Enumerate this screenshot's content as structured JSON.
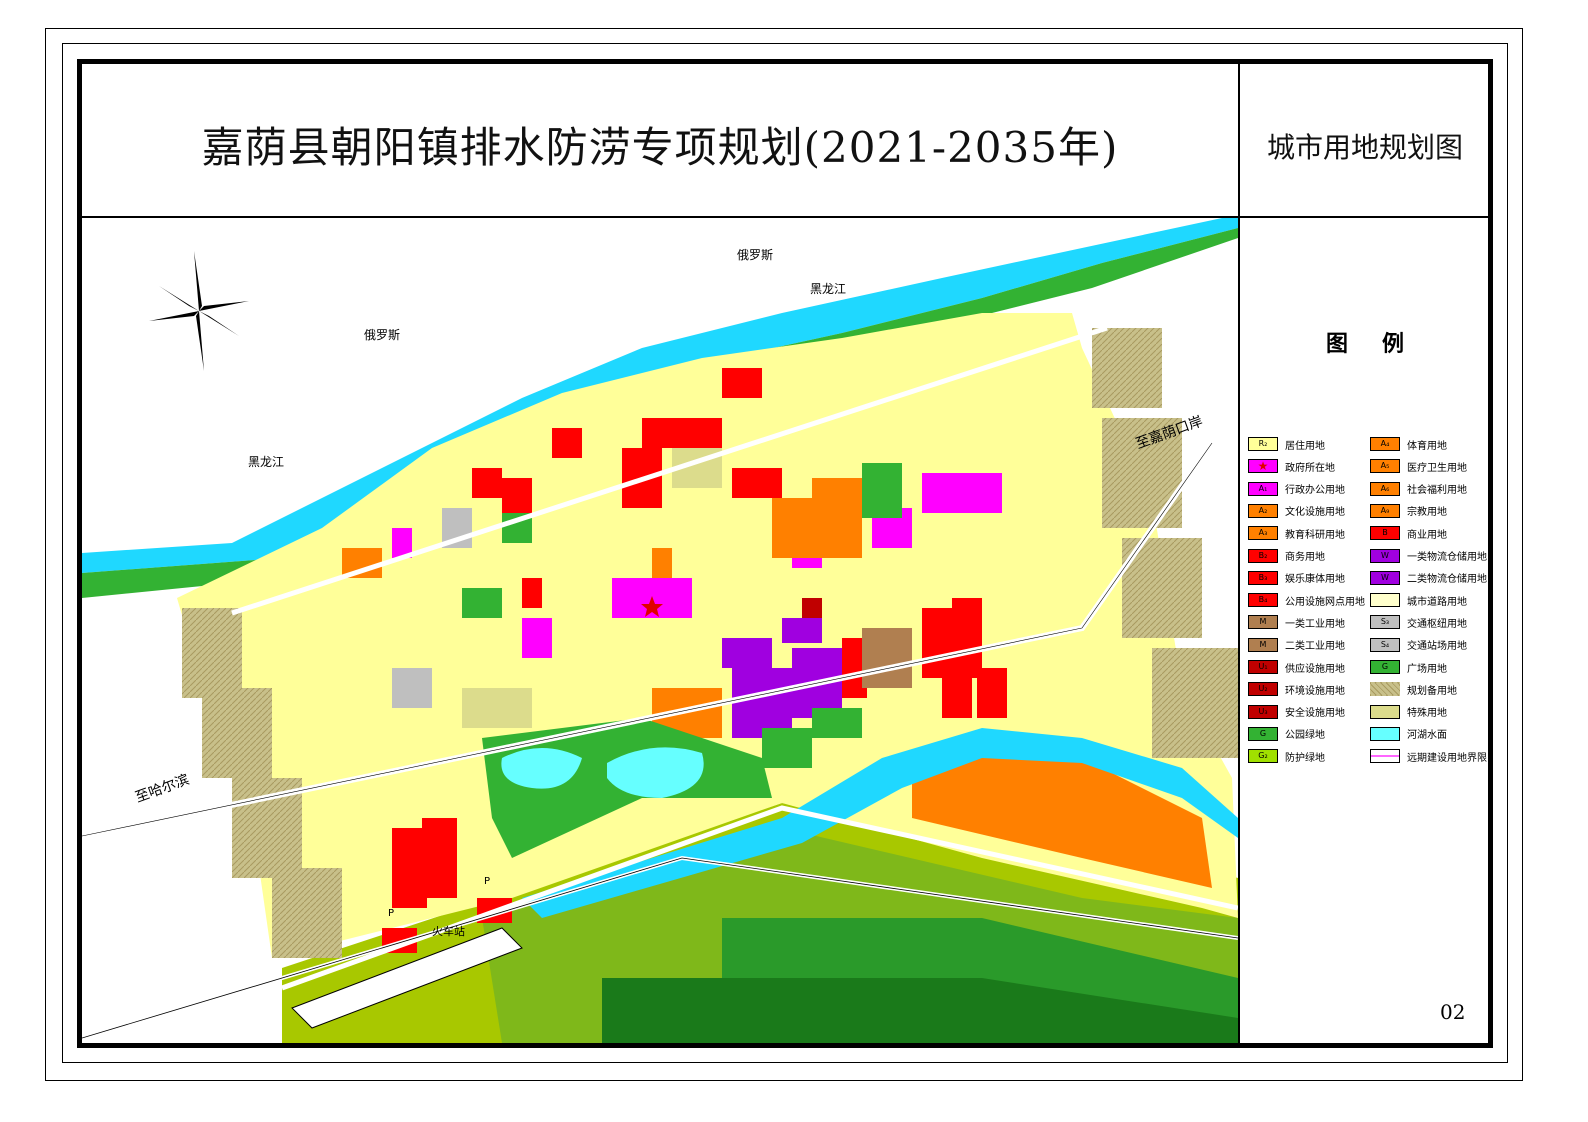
{
  "title": "嘉荫县朝阳镇排水防涝专项规划(2021-2035年)",
  "subtitle": "城市用地规划图",
  "legend_heading": "图例",
  "page_number": "02",
  "map_labels": {
    "russia_1": "俄罗斯",
    "russia_2": "俄罗斯",
    "heilongjiang_1": "黑龙江",
    "heilongjiang_2": "黑龙江",
    "to_jiayin_port": "至嘉荫口岸",
    "to_harbin": "至哈尔滨",
    "train_station": "火车站",
    "parking_1": "P",
    "parking_2": "P"
  },
  "colors": {
    "residential": "#ffff99",
    "government": "#ff00ff",
    "culture": "#ff8000",
    "commercial": "#ff0000",
    "industrial": "#b07f50",
    "utility": "#c00000",
    "park": "#33b233",
    "protective": "#a0e000",
    "warehouse": "#a000e0",
    "reserve": "#c8c08a",
    "special": "#dcdc8c",
    "water": "#66ffff",
    "road": "#ffffff",
    "landscape_dark": "#2a9a2a",
    "landscape_light": "#a8c800"
  },
  "legend_left": [
    {
      "code": "R₂",
      "label": "居住用地",
      "color": "#ffff99",
      "icon": "square"
    },
    {
      "code": "★",
      "label": "政府所在地",
      "color": "#ff00ff",
      "icon": "star"
    },
    {
      "code": "A₁",
      "label": "行政办公用地",
      "color": "#ff00ff",
      "icon": "square"
    },
    {
      "code": "A₂",
      "label": "文化设施用地",
      "color": "#ff8000",
      "icon": "square"
    },
    {
      "code": "A₃",
      "label": "教育科研用地",
      "color": "#ff8000",
      "icon": "square"
    },
    {
      "code": "B₂",
      "label": "商务用地",
      "color": "#ff0000",
      "icon": "square"
    },
    {
      "code": "B₃",
      "label": "娱乐康体用地",
      "color": "#ff0000",
      "icon": "square"
    },
    {
      "code": "B₄",
      "label": "公用设施网点用地",
      "color": "#ff0000",
      "icon": "square"
    },
    {
      "code": "M",
      "label": "一类工业用地",
      "color": "#b07f50",
      "icon": "square"
    },
    {
      "code": "M",
      "label": "二类工业用地",
      "color": "#b07f50",
      "icon": "square"
    },
    {
      "code": "U₁",
      "label": "供应设施用地",
      "color": "#c00000",
      "icon": "square"
    },
    {
      "code": "U₂",
      "label": "环境设施用地",
      "color": "#c00000",
      "icon": "square"
    },
    {
      "code": "U₃",
      "label": "安全设施用地",
      "color": "#c00000",
      "icon": "square"
    },
    {
      "code": "G",
      "label": "公园绿地",
      "color": "#33b233",
      "icon": "square"
    },
    {
      "code": "G₂",
      "label": "防护绿地",
      "color": "#a0e000",
      "icon": "square"
    }
  ],
  "legend_right": [
    {
      "code": "A₄",
      "label": "体育用地",
      "color": "#ff8000",
      "icon": "square"
    },
    {
      "code": "A₅",
      "label": "医疗卫生用地",
      "color": "#ff8000",
      "icon": "square"
    },
    {
      "code": "A₆",
      "label": "社会福利用地",
      "color": "#ff8000",
      "icon": "square"
    },
    {
      "code": "A₉",
      "label": "宗教用地",
      "color": "#ff8000",
      "icon": "square"
    },
    {
      "code": "B",
      "label": "商业用地",
      "color": "#ff0000",
      "icon": "square"
    },
    {
      "code": "W",
      "label": "一类物流仓储用地",
      "color": "#a000e0",
      "icon": "square"
    },
    {
      "code": "W",
      "label": "二类物流仓储用地",
      "color": "#a000e0",
      "icon": "square"
    },
    {
      "code": "",
      "label": "城市道路用地",
      "color": "#ffffff",
      "icon": "road"
    },
    {
      "code": "S₃",
      "label": "交通枢纽用地",
      "color": "#bfbfbf",
      "icon": "square"
    },
    {
      "code": "S₄",
      "label": "交通站场用地",
      "color": "#bfbfbf",
      "icon": "square"
    },
    {
      "code": "G",
      "label": "广场用地",
      "color": "#33b233",
      "icon": "square"
    },
    {
      "code": "",
      "label": "规划备用地",
      "color": "#c8c08a",
      "icon": "hatch"
    },
    {
      "code": "",
      "label": "特殊用地",
      "color": "#dcdc8c",
      "icon": "square"
    },
    {
      "code": "",
      "label": "河湖水面",
      "color": "#66ffff",
      "icon": "water"
    },
    {
      "code": "",
      "label": "远期建设用地界限",
      "color": "#ff66ff",
      "icon": "boundary"
    }
  ]
}
